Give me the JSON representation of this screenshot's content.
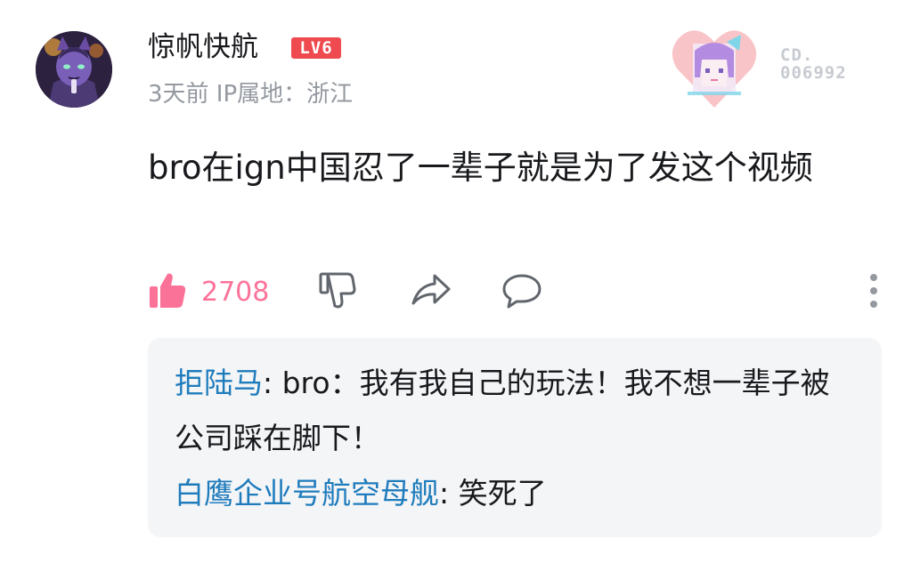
{
  "comment": {
    "username": "惊帆快航",
    "level_badge": "LV6",
    "meta": "3天前 IP属地：浙江",
    "fan_card_number": "CD.\n006992",
    "content": "bro在ign中国忍了一辈子就是为了发这个视频",
    "like_count": "2708"
  },
  "replies": [
    {
      "name": "拒陆马",
      "sep": ": ",
      "text": "bro：我有我自己的玩法！我不想一辈子被公司踩在脚下！"
    },
    {
      "name": "白鹰企业号航空母舰",
      "sep": ": ",
      "text": "笑死了"
    }
  ],
  "icons": {
    "like": "thumbs-up-icon",
    "dislike": "thumbs-down-icon",
    "share": "share-arrow-icon",
    "reply": "speech-bubble-icon",
    "more": "vertical-dots-icon"
  },
  "colors": {
    "like_active": "#fb7299",
    "reply_name": "#1f7cbc",
    "level_badge": "#ee4a4f",
    "muted_text": "#9499a0",
    "reply_bg": "#f4f5f7"
  }
}
